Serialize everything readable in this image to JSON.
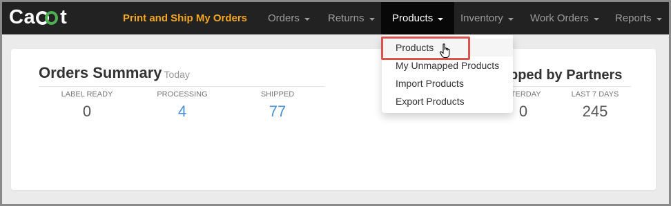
{
  "navbar": {
    "logo_text_a": "Ca",
    "logo_text_b": "t",
    "print_ship": "Print and Ship My Orders",
    "items": [
      {
        "label": "Orders"
      },
      {
        "label": "Returns"
      },
      {
        "label": "Products"
      },
      {
        "label": "Inventory"
      },
      {
        "label": "Work Orders"
      },
      {
        "label": "Reports"
      }
    ]
  },
  "orders_summary": {
    "title": "Orders Summary",
    "subtitle": "Today",
    "stats": [
      {
        "label": "LABEL READY",
        "value": "0"
      },
      {
        "label": "PROCESSING",
        "value": "4"
      },
      {
        "label": "SHIPPED",
        "value": "77"
      }
    ]
  },
  "partners": {
    "title": "pped by Partners",
    "stats": [
      {
        "label": "STERDAY",
        "value": "0"
      },
      {
        "label": "LAST 7 DAYS",
        "value": "245"
      }
    ]
  },
  "products_menu": {
    "items": [
      {
        "label": "Products"
      },
      {
        "label": "My Unmapped Products"
      },
      {
        "label": "Import Products"
      },
      {
        "label": "Export Products"
      }
    ]
  },
  "colors": {
    "navbar_bg": "#222222",
    "brand_orange": "#f5a623",
    "logo_green": "#4caf50",
    "link_blue": "#4a90d9",
    "highlight_red": "#d9534f"
  }
}
